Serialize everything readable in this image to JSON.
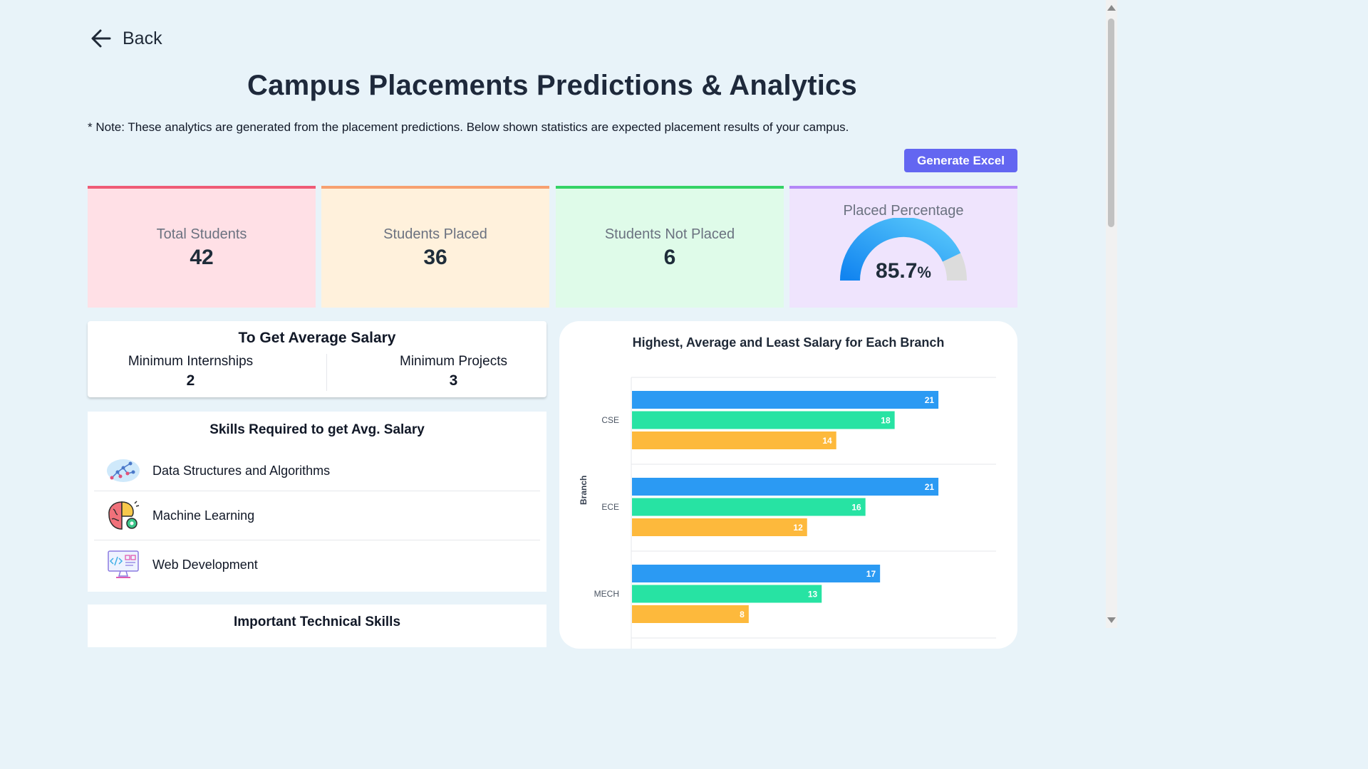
{
  "back": {
    "label": "Back"
  },
  "page_title": "Campus Placements Predictions & Analytics",
  "note": "* Note: These analytics are generated from the placement predictions. Below shown statistics are expected placement results of your campus.",
  "generate_button": "Generate Excel",
  "stats": [
    {
      "label": "Total Students",
      "value": "42"
    },
    {
      "label": "Students Placed",
      "value": "36"
    },
    {
      "label": "Students Not Placed",
      "value": "6"
    }
  ],
  "placed_percentage": {
    "label": "Placed Percentage",
    "value": "85.7",
    "unit": "%",
    "fraction": 0.857
  },
  "avg_salary": {
    "heading": "To Get Average Salary",
    "internships_label": "Minimum Internships",
    "internships_value": "2",
    "projects_label": "Minimum Projects",
    "projects_value": "3"
  },
  "skills": {
    "heading": "Skills Required to get Avg. Salary",
    "items": [
      {
        "name": "Data Structures and Algorithms",
        "icon": "dsa-icon"
      },
      {
        "name": "Machine Learning",
        "icon": "brain-icon"
      },
      {
        "name": "Web Development",
        "icon": "monitor-code-icon"
      }
    ]
  },
  "technical_skills": {
    "heading": "Important Technical Skills"
  },
  "colors": {
    "highest": "#2b9af3",
    "average": "#27e3a3",
    "least": "#fdb93c",
    "accent": "#6366f1"
  },
  "chart_data": {
    "type": "bar",
    "orientation": "horizontal",
    "title": "Highest, Average and Least Salary for Each Branch",
    "ylabel": "Branch",
    "categories": [
      "CSE",
      "ECE",
      "MECH"
    ],
    "series": [
      {
        "values": [
          21,
          21,
          17
        ]
      },
      {
        "values": [
          18,
          16,
          13
        ]
      },
      {
        "values": [
          14,
          12,
          8
        ]
      }
    ],
    "xlim": [
      0,
      25
    ],
    "grid": true
  }
}
